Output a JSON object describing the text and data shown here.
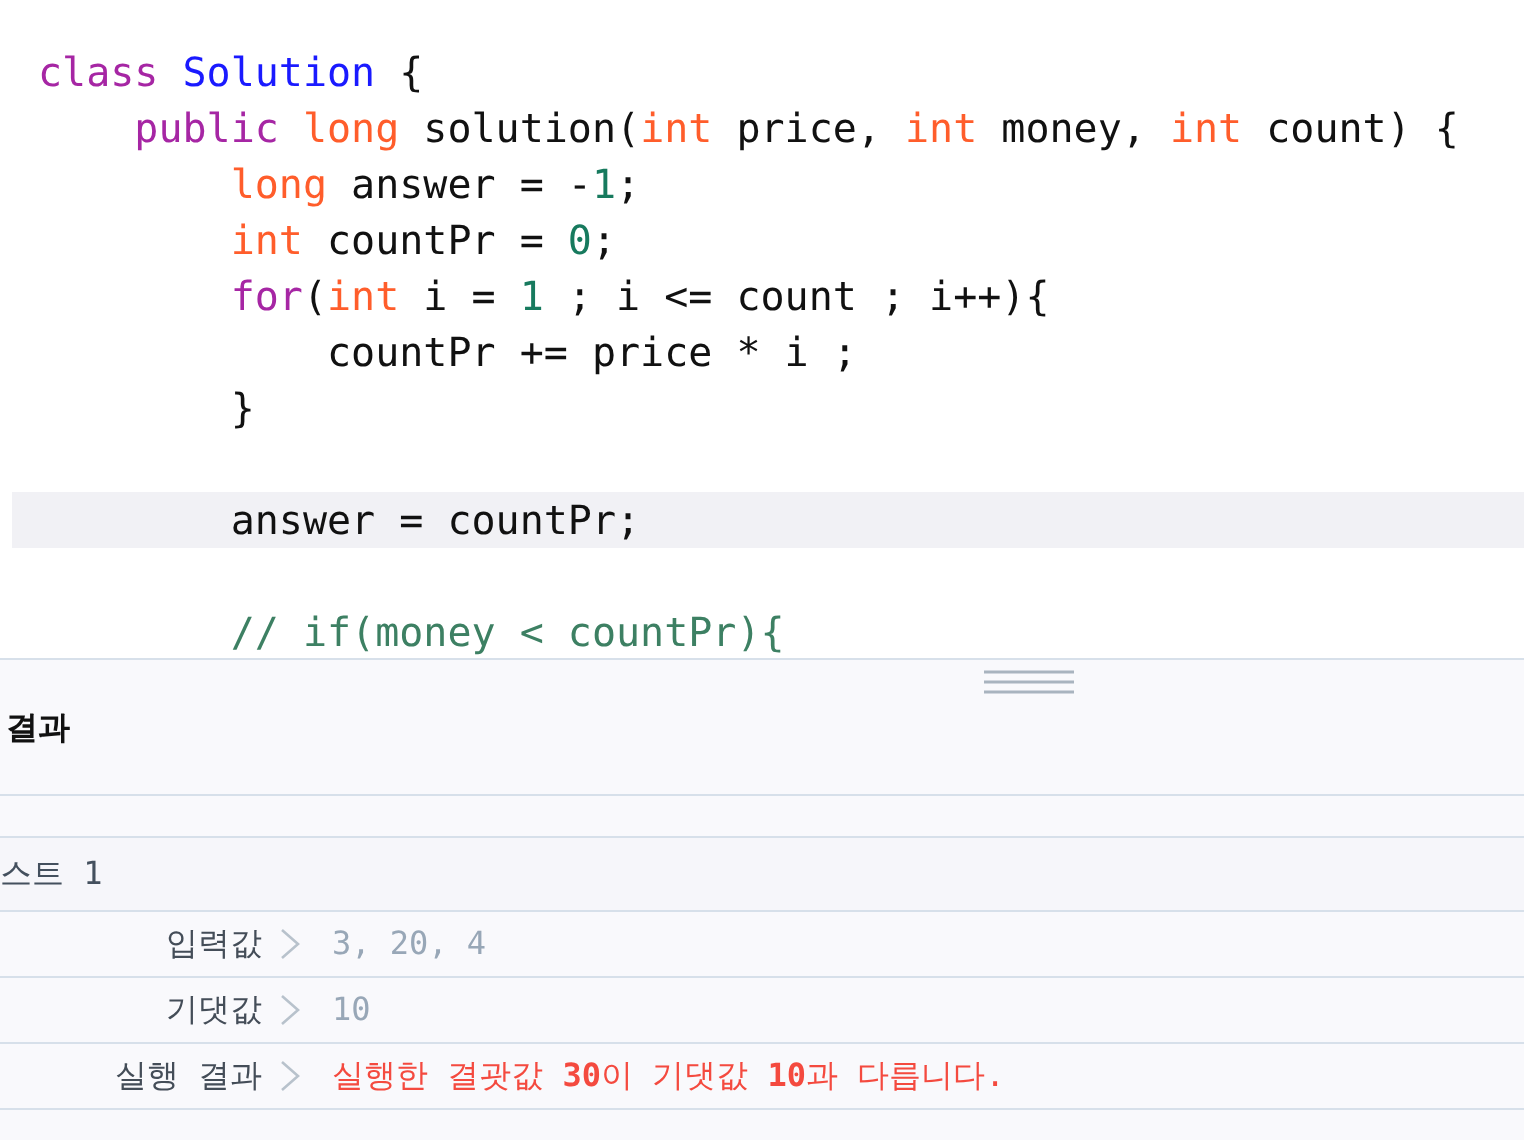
{
  "editor": {
    "lines": [
      {
        "active": false,
        "tokens": [
          {
            "kind": "keyword",
            "text": "class"
          },
          {
            "kind": "classname",
            "text": " Solution"
          },
          {
            "kind": "plain",
            "text": " {"
          }
        ]
      },
      {
        "active": false,
        "tokens": [
          {
            "kind": "keyword",
            "text": "    public"
          },
          {
            "kind": "type",
            "text": " long"
          },
          {
            "kind": "plain",
            "text": " solution("
          },
          {
            "kind": "type",
            "text": "int"
          },
          {
            "kind": "plain",
            "text": " price, "
          },
          {
            "kind": "type",
            "text": "int"
          },
          {
            "kind": "plain",
            "text": " money, "
          },
          {
            "kind": "type",
            "text": "int"
          },
          {
            "kind": "plain",
            "text": " count) {"
          }
        ]
      },
      {
        "active": false,
        "tokens": [
          {
            "kind": "type",
            "text": "        long"
          },
          {
            "kind": "plain",
            "text": " answer = -"
          },
          {
            "kind": "number",
            "text": "1"
          },
          {
            "kind": "plain",
            "text": ";"
          }
        ]
      },
      {
        "active": false,
        "tokens": [
          {
            "kind": "type",
            "text": "        int"
          },
          {
            "kind": "plain",
            "text": " countPr = "
          },
          {
            "kind": "number",
            "text": "0"
          },
          {
            "kind": "plain",
            "text": ";"
          }
        ]
      },
      {
        "active": false,
        "tokens": [
          {
            "kind": "keyword",
            "text": "        for"
          },
          {
            "kind": "plain",
            "text": "("
          },
          {
            "kind": "type",
            "text": "int"
          },
          {
            "kind": "plain",
            "text": " i = "
          },
          {
            "kind": "number",
            "text": "1"
          },
          {
            "kind": "plain",
            "text": " ; i <= count ; i++){"
          }
        ]
      },
      {
        "active": false,
        "tokens": [
          {
            "kind": "plain",
            "text": "            countPr += price * i ;"
          }
        ]
      },
      {
        "active": false,
        "tokens": [
          {
            "kind": "plain",
            "text": "        }"
          }
        ]
      },
      {
        "active": false
      },
      {
        "active": true,
        "tokens": [
          {
            "kind": "plain",
            "text": "        answer = countPr;"
          }
        ]
      },
      {
        "active": false
      },
      {
        "active": false,
        "tokens": [
          {
            "kind": "comment",
            "text": "        // if(money < countPr){"
          }
        ]
      }
    ]
  },
  "results": {
    "title": "결과",
    "test": {
      "title": "스트 1",
      "rows": [
        {
          "kind": "normal",
          "label": "입력값",
          "value": "3, 20, 4"
        },
        {
          "kind": "normal",
          "label": "기댓값",
          "value": "10"
        },
        {
          "kind": "error",
          "label": "실행 결과",
          "value": "실행한 결괏값 **30**이 기댓값 **10**과 다릅니다."
        }
      ]
    }
  }
}
